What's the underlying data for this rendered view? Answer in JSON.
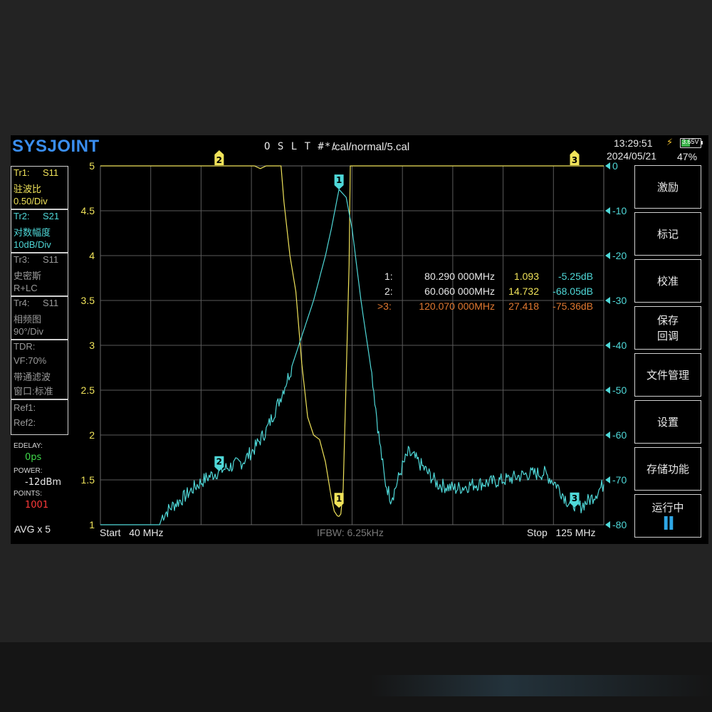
{
  "header": {
    "logo": "SYSJOINT",
    "cal_label": "O S L T #*:",
    "cal_path": "/cal/normal/5.cal",
    "time": "13:29:51",
    "date": "2024/05/21",
    "battery_voltage": "3.65V",
    "battery_percent": "47%"
  },
  "traces": {
    "tr1": {
      "id": "Tr1:",
      "param": "S11",
      "format": "驻波比",
      "scale": "0.50/Div"
    },
    "tr2": {
      "id": "Tr2:",
      "param": "S21",
      "format": "对数幅度",
      "scale": "10dB/Div"
    },
    "tr3": {
      "id": "Tr3:",
      "param": "S11",
      "format": "史密斯",
      "scale": "R+LC"
    },
    "tr4": {
      "id": "Tr4:",
      "param": "S11",
      "format": "相频图",
      "scale": "90°/Div"
    },
    "tdr": {
      "label": "TDR:",
      "vf": "VF:70%",
      "mode": "带通滤波",
      "window": "窗口:标准"
    },
    "ref1": "Ref1:",
    "ref2": "Ref2:"
  },
  "settings": {
    "edelay_label": "EDELAY:",
    "edelay_value": "0ps",
    "power_label": "POWER:",
    "power_value": "-12dBm",
    "points_label": "POINTS:",
    "points_value": "1001",
    "avg": "AVG x 5"
  },
  "axes": {
    "left_ticks": [
      "5",
      "4.5",
      "4",
      "3.5",
      "3",
      "2.5",
      "2",
      "1.5",
      "1"
    ],
    "right_ticks": [
      "0",
      "-10",
      "-20",
      "-30",
      "-40",
      "-50",
      "-60",
      "-70",
      "-80"
    ]
  },
  "footer": {
    "start_label": "Start",
    "start_value": "40 MHz",
    "ifbw": "IFBW: 6.25kHz",
    "stop_label": "Stop",
    "stop_value": "125 MHz"
  },
  "markers": [
    {
      "id": "1:",
      "freq": "80.290 000MHz",
      "swr": "1.093",
      "db": "-5.25dB",
      "color": "#e8e8e8",
      "value_colors": [
        "#f0e35a",
        "#4fd8d8"
      ]
    },
    {
      "id": "2:",
      "freq": "60.060 000MHz",
      "swr": "14.732",
      "db": "-68.05dB",
      "color": "#e8e8e8",
      "value_colors": [
        "#f0e35a",
        "#4fd8d8"
      ]
    },
    {
      "id": ">3:",
      "freq": "120.070 000MHz",
      "swr": "27.418",
      "db": "-75.36dB",
      "color": "#e07830",
      "value_colors": [
        "#e07830",
        "#e07830"
      ]
    }
  ],
  "marker_flags": {
    "m1": "1",
    "m2": "2",
    "m3": "3"
  },
  "softkeys": [
    {
      "label": "激励"
    },
    {
      "label": "标记"
    },
    {
      "label": "校准"
    },
    {
      "label": "保存",
      "label2": "回调"
    },
    {
      "label": "文件管理"
    },
    {
      "label": "设置"
    },
    {
      "label": "存储功能"
    },
    {
      "label": "运行中",
      "indicator": "II"
    }
  ],
  "chart_data": {
    "type": "line",
    "x_range_mhz": [
      40,
      125
    ],
    "y_left_range": [
      1,
      5
    ],
    "y_right_range_db": [
      -80,
      0
    ],
    "grid": true,
    "series": [
      {
        "name": "Tr1: S11",
        "color": "#f0e35a",
        "axis": "left",
        "x": [
          40,
          60,
          62,
          63,
          64,
          65,
          66,
          67,
          68,
          69,
          70,
          70.5,
          71,
          72,
          73,
          74,
          75,
          76,
          77,
          78,
          79,
          79.5,
          80,
          80.29,
          80.6,
          81,
          81.4,
          82,
          82.2,
          82.6,
          83,
          84,
          90,
          100,
          110,
          120,
          125
        ],
        "y": [
          5,
          5,
          5,
          5,
          5,
          5,
          5,
          4.97,
          5,
          5,
          5,
          5,
          4.6,
          4.0,
          3.6,
          2.8,
          2.2,
          2.0,
          1.95,
          1.7,
          1.3,
          1.15,
          1.1,
          1.093,
          1.12,
          1.4,
          2.4,
          3.9,
          5,
          5,
          5,
          5,
          5,
          5,
          5,
          5,
          5
        ]
      },
      {
        "name": "Tr2: S21",
        "color": "#4fd8d8",
        "axis": "right",
        "x": [
          40,
          44,
          48,
          50,
          50.5,
          52,
          54,
          56,
          58,
          60.06,
          62,
          64,
          66,
          67,
          68,
          70,
          72,
          74,
          76,
          78,
          79,
          80.29,
          81.5,
          82.5,
          84,
          86,
          87,
          88,
          89,
          89.5,
          90,
          91,
          92,
          93,
          95,
          97,
          100,
          103,
          106,
          109,
          112,
          115,
          117,
          118,
          119,
          120.07,
          121,
          123,
          125
        ],
        "y": [
          -80,
          -80,
          -80,
          -80,
          -78,
          -76,
          -74,
          -71.5,
          -69.5,
          -68.05,
          -67,
          -66,
          -63,
          -61,
          -59,
          -53,
          -46,
          -38,
          -30,
          -20,
          -14,
          -5.25,
          -7,
          -14,
          -30,
          -48,
          -60,
          -70,
          -74,
          -73,
          -71,
          -67,
          -64,
          -65,
          -68,
          -71,
          -72,
          -71,
          -70.5,
          -69.8,
          -68.7,
          -68.5,
          -71,
          -73,
          -75,
          -75.36,
          -76,
          -74,
          -71
        ]
      }
    ],
    "markers": [
      {
        "id": "1",
        "freq_mhz": 80.29,
        "swr": 1.093,
        "s21_db": -5.25
      },
      {
        "id": "2",
        "freq_mhz": 60.06,
        "swr": 14.732,
        "s21_db": -68.05
      },
      {
        "id": "3",
        "freq_mhz": 120.07,
        "swr": 27.418,
        "s21_db": -75.36
      }
    ]
  }
}
